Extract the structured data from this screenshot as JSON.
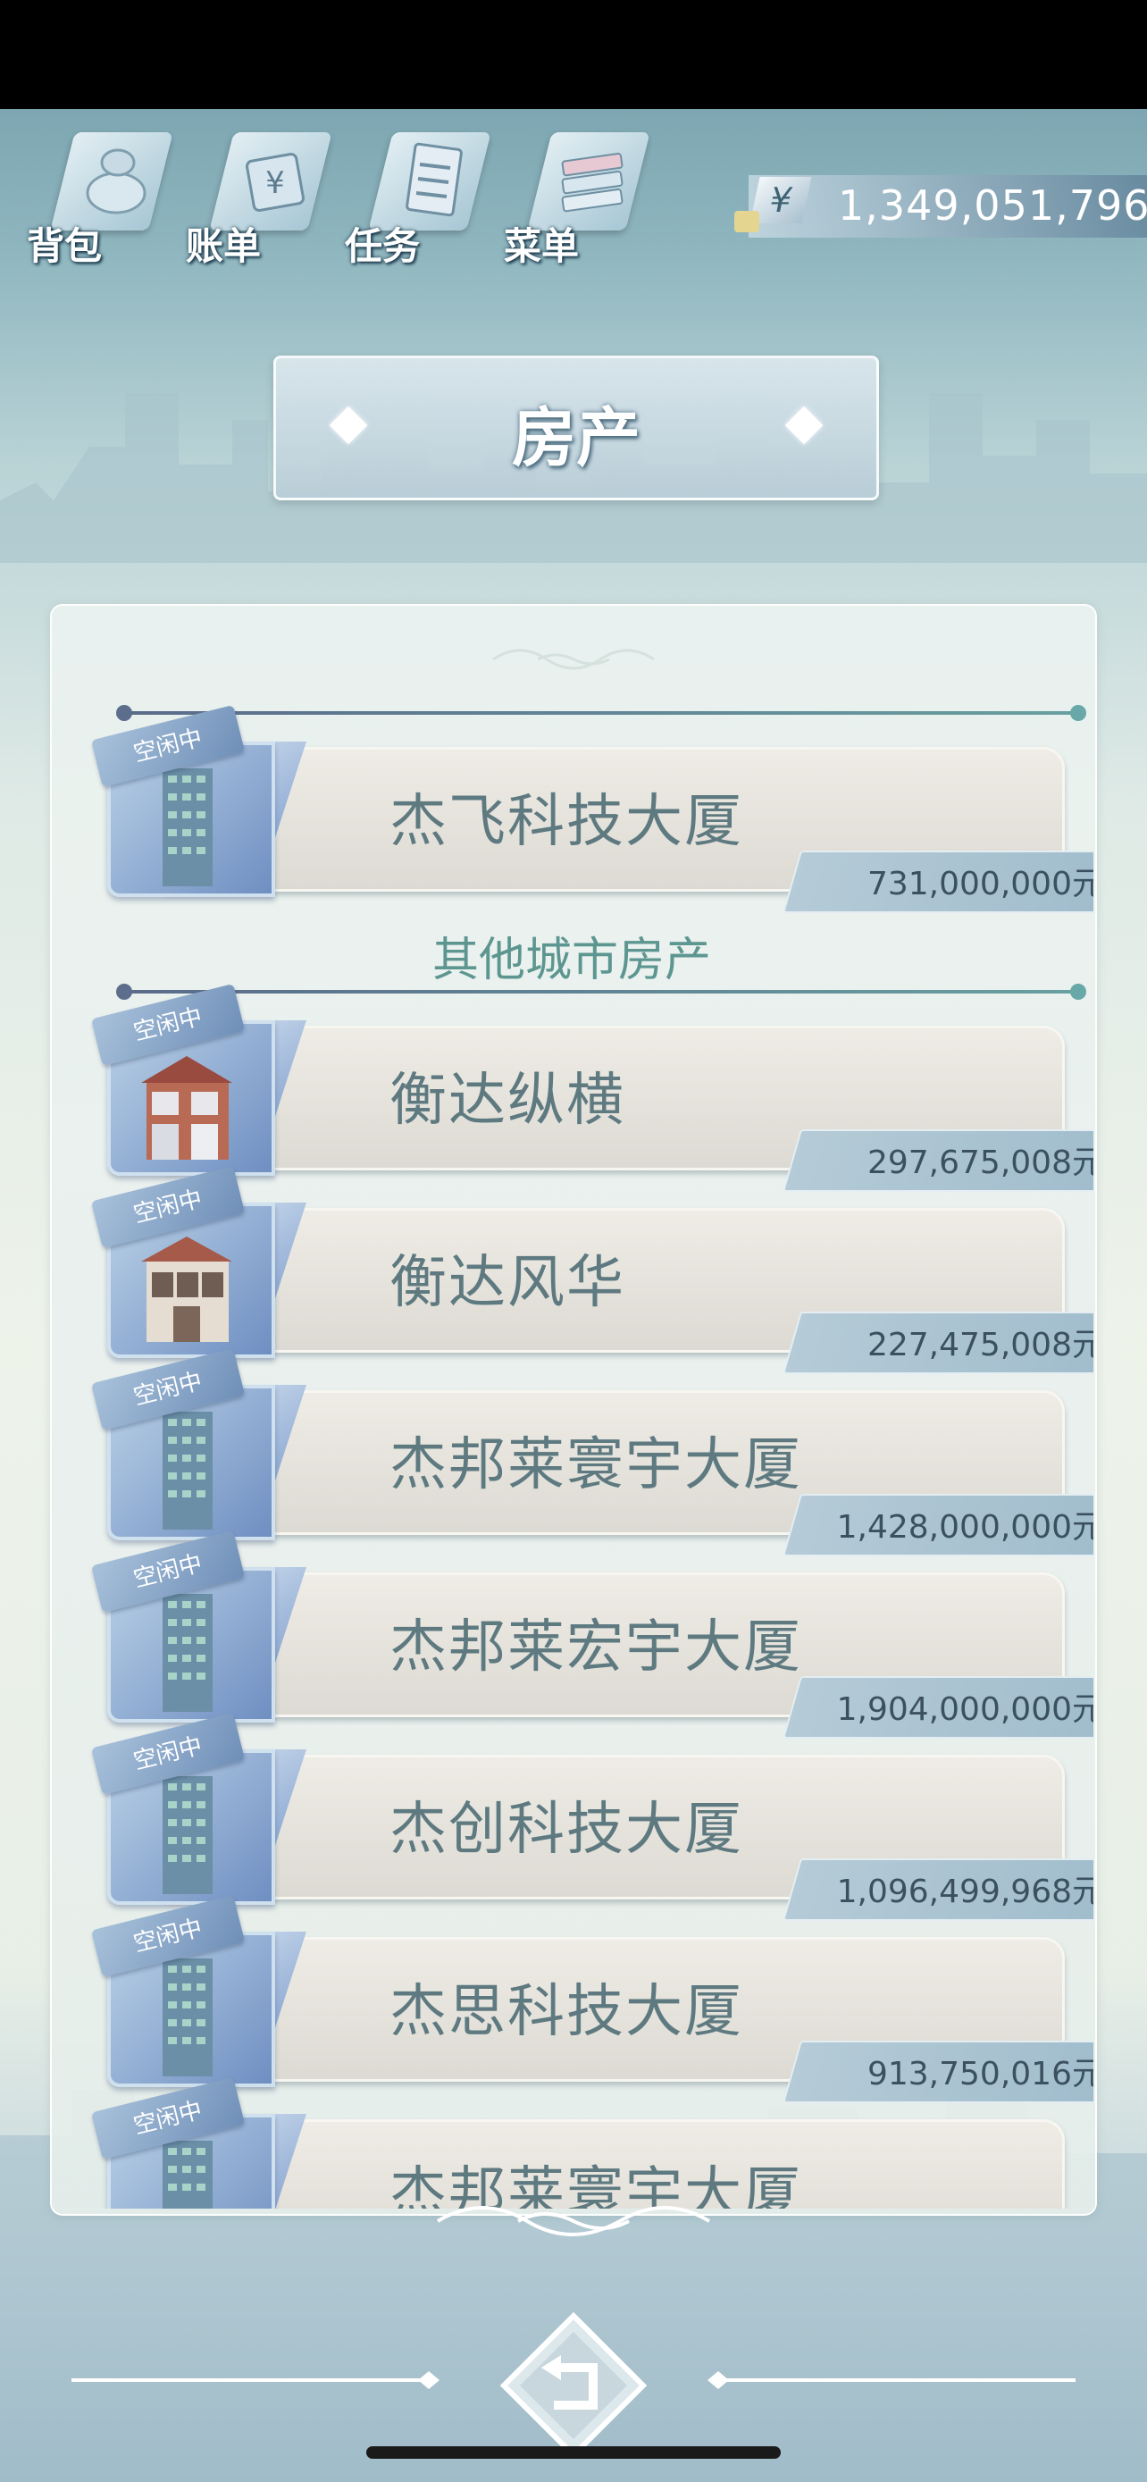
{
  "topnav": {
    "items": [
      {
        "label": "背包",
        "icon": "bag-icon"
      },
      {
        "label": "账单",
        "icon": "bill-icon"
      },
      {
        "label": "任务",
        "icon": "task-icon"
      },
      {
        "label": "菜单",
        "icon": "menu-icon"
      }
    ]
  },
  "money": {
    "symbol": "¥",
    "amount": "1,349,051,796"
  },
  "title": "房产",
  "section_other": "其他城市房产",
  "properties": [
    {
      "status": "空闲中",
      "name": "杰飞科技大厦",
      "price": "731,000,000元",
      "type": "tower"
    },
    {
      "status": "空闲中",
      "name": "衡达纵横",
      "price": "297,675,008元",
      "type": "villa"
    },
    {
      "status": "空闲中",
      "name": "衡达风华",
      "price": "227,475,008元",
      "type": "villa"
    },
    {
      "status": "空闲中",
      "name": "杰邦莱寰宇大厦",
      "price": "1,428,000,000元",
      "type": "tower"
    },
    {
      "status": "空闲中",
      "name": "杰邦莱宏宇大厦",
      "price": "1,904,000,000元",
      "type": "tower"
    },
    {
      "status": "空闲中",
      "name": "杰创科技大厦",
      "price": "1,096,499,968元",
      "type": "tower"
    },
    {
      "status": "空闲中",
      "name": "杰思科技大厦",
      "price": "913,750,016元",
      "type": "tower"
    },
    {
      "status": "空闲中",
      "name": "杰邦莱寰宇大厦",
      "price": "",
      "type": "tower"
    }
  ],
  "icons": {
    "back": "back-arrow-icon"
  },
  "colors": {
    "accent": "#5d9690",
    "card": "#e6e3dc",
    "tag": "#8fa9c8"
  }
}
